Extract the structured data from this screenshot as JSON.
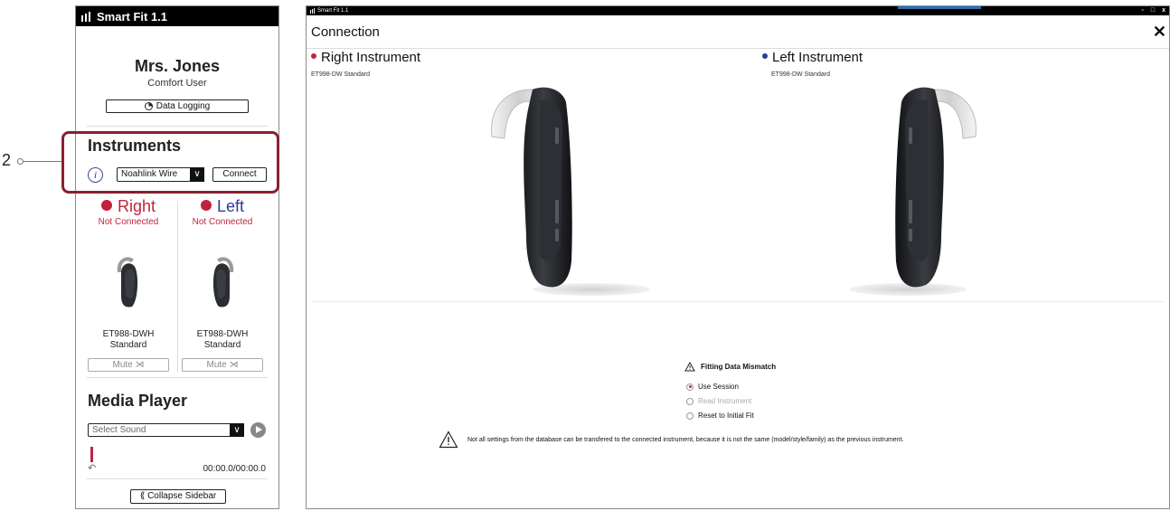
{
  "callout": {
    "number": "2"
  },
  "sidebar": {
    "app_title": "Smart Fit 1.1",
    "patient_name": "Mrs. Jones",
    "patient_sub": "Comfort User",
    "data_logging_label": "Data Logging",
    "instruments_heading": "Instruments",
    "connection_select": "Noahlink Wire",
    "connect_label": "Connect",
    "right": {
      "label": "Right",
      "status": "Not Connected",
      "model": "ET988-DWH",
      "style": "Standard",
      "mute_label": "Mute"
    },
    "left": {
      "label": "Left",
      "status": "Not Connected",
      "model": "ET988-DWH",
      "style": "Standard",
      "mute_label": "Mute"
    },
    "media_heading": "Media Player",
    "sound_select_placeholder": "Select Sound",
    "time_readout": "00:00.0/00:00.0",
    "collapse_label": "Collapse Sidebar"
  },
  "main": {
    "window_title": "Smart Fit 1.1",
    "window_controls": [
      "-",
      "□",
      "x"
    ],
    "page_title": "Connection",
    "right_instrument": {
      "title": "Right Instrument",
      "subtitle": "ET998-DW  Standard"
    },
    "left_instrument": {
      "title": "Left Instrument",
      "subtitle": "ET998-DW  Standard"
    },
    "mismatch_heading": "Fitting Data Mismatch",
    "options": [
      {
        "label": "Use Session",
        "selected": true,
        "enabled": true
      },
      {
        "label": "Read Instrument",
        "selected": false,
        "enabled": false
      },
      {
        "label": "Reset to Initial Fit",
        "selected": false,
        "enabled": true
      }
    ],
    "warning_text": "Not all settings from the database can be transfered to the connected instrument, because it is not the same (model/style/family) as the previous instrument."
  },
  "colors": {
    "right_red": "#c0243c",
    "left_blue": "#2f3c94",
    "highlight": "#8a1f32",
    "titlebar": "#000000"
  }
}
